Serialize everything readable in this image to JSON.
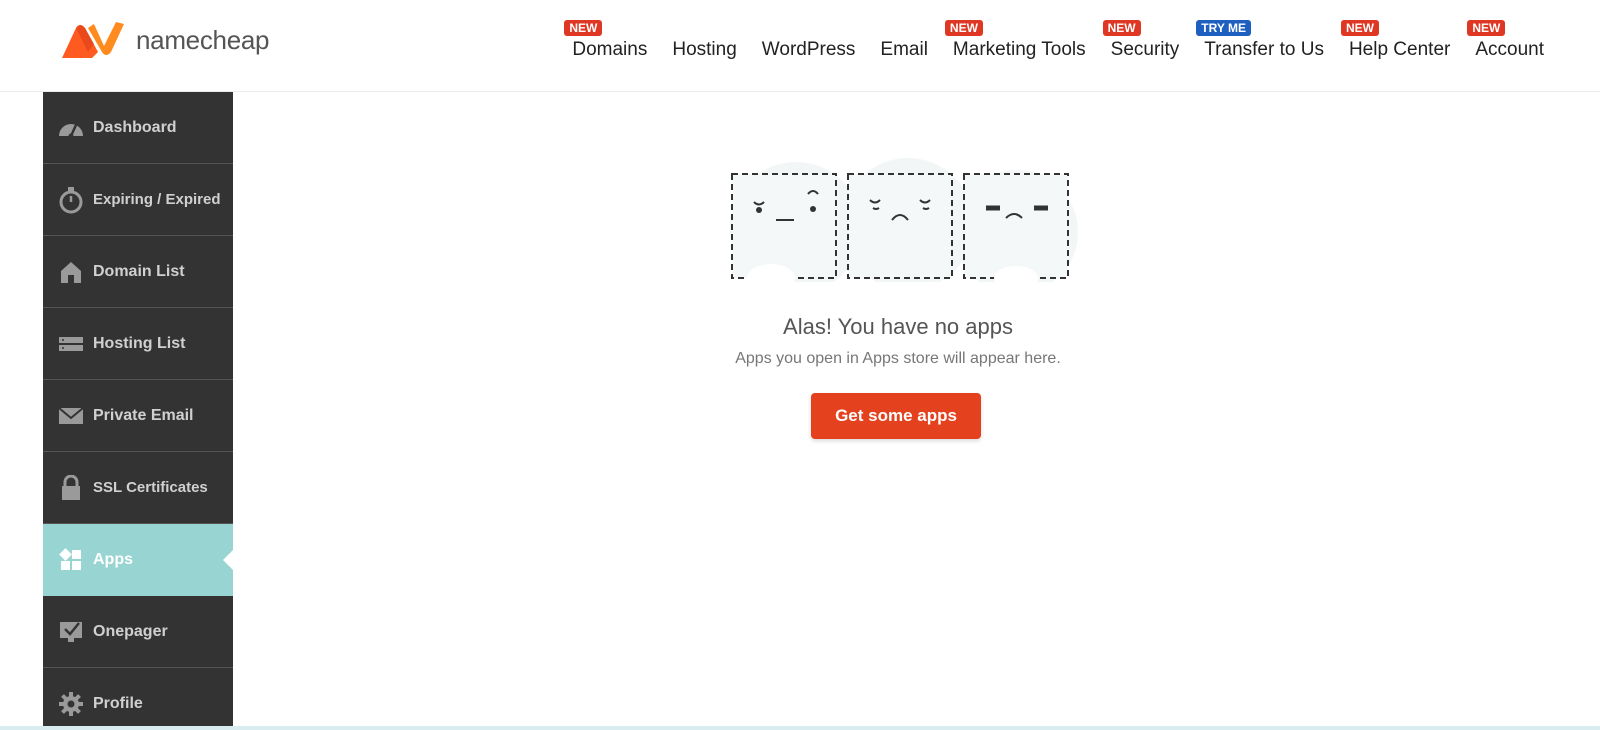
{
  "brand": {
    "name": "namecheap",
    "color": "#ff6b1a"
  },
  "nav": {
    "items": [
      {
        "label": "Domains",
        "badge": "NEW"
      },
      {
        "label": "Hosting",
        "badge": ""
      },
      {
        "label": "WordPress",
        "badge": ""
      },
      {
        "label": "Email",
        "badge": ""
      },
      {
        "label": "Marketing Tools",
        "badge": "NEW"
      },
      {
        "label": "Security",
        "badge": "NEW"
      },
      {
        "label": "Transfer to Us",
        "badge": "TRY ME"
      },
      {
        "label": "Help Center",
        "badge": "NEW"
      },
      {
        "label": "Account",
        "badge": "NEW"
      }
    ]
  },
  "sidebar": {
    "items": [
      {
        "label": "Dashboard",
        "icon": "speedometer-icon"
      },
      {
        "label": "Expiring / Expired",
        "icon": "stopwatch-icon"
      },
      {
        "label": "Domain List",
        "icon": "home-icon"
      },
      {
        "label": "Hosting List",
        "icon": "server-icon"
      },
      {
        "label": "Private Email",
        "icon": "envelope-icon"
      },
      {
        "label": "SSL Certificates",
        "icon": "lock-icon"
      },
      {
        "label": "Apps",
        "icon": "apps-grid-icon",
        "active": true
      },
      {
        "label": "Onepager",
        "icon": "onepager-check-icon"
      },
      {
        "label": "Profile",
        "icon": "gear-icon"
      }
    ]
  },
  "empty_state": {
    "title": "Alas! You have no apps",
    "subtitle": "Apps you open in Apps store will appear here.",
    "button_label": "Get some apps"
  },
  "colors": {
    "accent": "#e4421f",
    "sidebar_bg": "#333333",
    "active_bg": "#97d4d2",
    "badge_red": "#de3723",
    "badge_blue": "#1f5fbf"
  }
}
